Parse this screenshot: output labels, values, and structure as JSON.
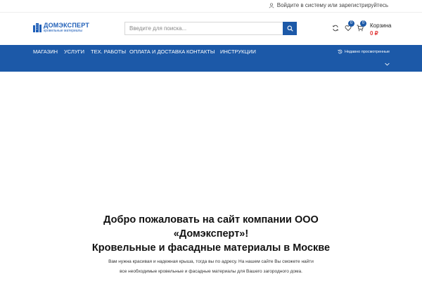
{
  "topbar": {
    "login_text": "Войдите в систему или зарегистрируйтесь",
    "user_icon": "user-icon"
  },
  "logo": {
    "title": "ДОМЭКСПЕРТ",
    "subtitle": "кровельные материалы",
    "icon": "building-logo-icon"
  },
  "search": {
    "placeholder": "Введите для поиска...",
    "value": "",
    "icon": "search-icon"
  },
  "header_icons": {
    "compare_icon": "refresh-compare-icon",
    "wishlist_icon": "heart-icon",
    "wishlist_count": "0",
    "cart_icon": "cart-icon",
    "cart_count": "0",
    "cart_label": "Корзина",
    "cart_total": "0 ₽"
  },
  "nav": {
    "items": [
      {
        "label": "МАГАЗИН"
      },
      {
        "label": "УСЛУГИ"
      },
      {
        "label": "ТЕХ. РАБОТЫ"
      },
      {
        "label": "ОПЛАТА И ДОСТАВКА"
      },
      {
        "label": "КОНТАКТЫ"
      },
      {
        "label": "ИНСТРУКЦИИ"
      }
    ],
    "recent_label": "Недавно просмотренные",
    "recent_icon": "history-icon",
    "chevron_icon": "chevron-down-icon"
  },
  "main": {
    "welcome_line1": "Добро пожаловать на сайт компании ООО",
    "welcome_line2": "«Домэксперт»!",
    "welcome_line3": "Кровельные и фасадные материалы в Москве",
    "desc_line1": "Вам нужна красивая и надежная крыша, тогда вы по адресу. На нашем сайте Вы сможете найти",
    "desc_line2": "все необходимые кровельные и фасадные материалы для Вашего загородного дома."
  },
  "colors": {
    "brand_blue": "#1c59a8",
    "price_red": "#e03a3a"
  }
}
